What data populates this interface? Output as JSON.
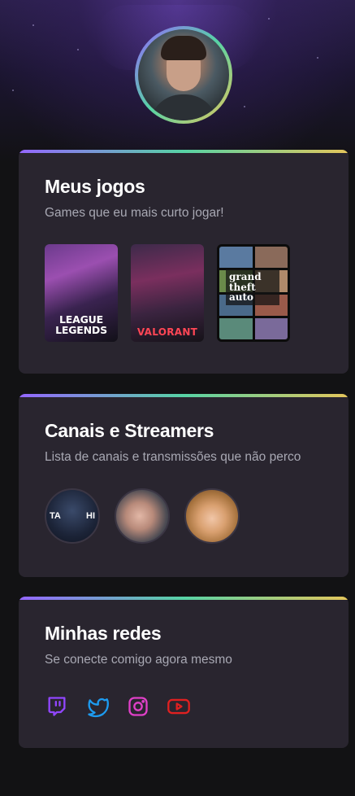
{
  "colors": {
    "background": "#121214",
    "card": "#29252F",
    "gradient_start": "#9466FF",
    "gradient_mid": "#57D3A5",
    "gradient_end": "#E4C65B",
    "twitch": "#9146FF",
    "twitter": "#1D9BF0",
    "instagram": "#E040C8",
    "youtube": "#E02020"
  },
  "profile": {
    "avatar_icon": "profile-avatar"
  },
  "games_section": {
    "title": "Meus jogos",
    "subtitle": "Games que eu mais curto jogar!",
    "games": [
      {
        "name": "League of Legends",
        "label_line1": "LEAGUE",
        "label_line2": "LEGENDS"
      },
      {
        "name": "Valorant",
        "label": "VALORANT"
      },
      {
        "name": "Grand Theft Auto V",
        "label_line1": "grand",
        "label_line2": "theft",
        "label_line3": "auto"
      }
    ]
  },
  "streamers_section": {
    "title": "Canais e Streamers",
    "subtitle": "Lista de canais e transmissões que não perco",
    "streamers": [
      {
        "left_text": "TA",
        "right_text": "HI"
      },
      {},
      {}
    ]
  },
  "socials_section": {
    "title": "Minhas redes",
    "subtitle": "Se conecte comigo agora mesmo",
    "links": [
      {
        "icon": "twitch-icon"
      },
      {
        "icon": "twitter-icon"
      },
      {
        "icon": "instagram-icon"
      },
      {
        "icon": "youtube-icon"
      }
    ]
  }
}
